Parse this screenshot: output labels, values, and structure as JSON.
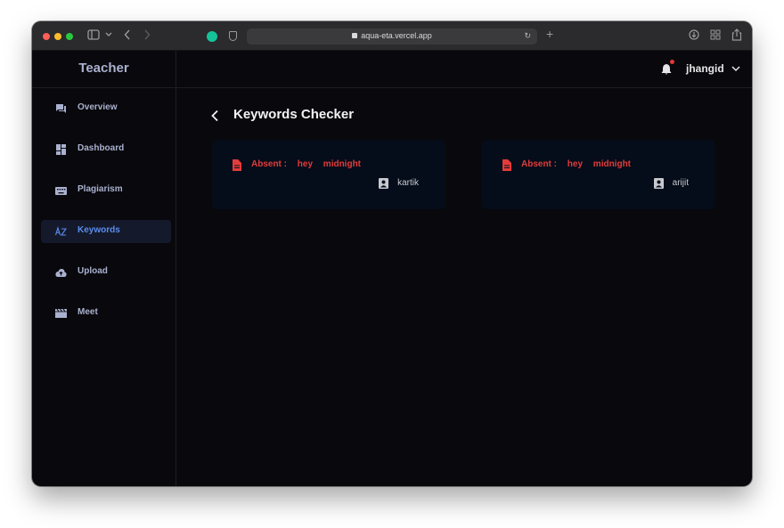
{
  "browser": {
    "url": "aqua-eta.vercel.app"
  },
  "app": {
    "brand": "Teacher",
    "user": "jhangid"
  },
  "sidebar": {
    "items": [
      {
        "label": "Overview",
        "icon": "forum-icon",
        "active": false
      },
      {
        "label": "Dashboard",
        "icon": "dashboard-icon",
        "active": false
      },
      {
        "label": "Plagiarism",
        "icon": "keyboard-icon",
        "active": false
      },
      {
        "label": "Keywords",
        "icon": "sort-by-alpha-icon",
        "active": true
      },
      {
        "label": "Upload",
        "icon": "cloud-upload-icon",
        "active": false
      },
      {
        "label": "Meet",
        "icon": "movie-icon",
        "active": false
      }
    ]
  },
  "page": {
    "title": "Keywords Checker"
  },
  "cards": [
    {
      "absent_label": "Absent :",
      "keywords": [
        "hey",
        "midnight"
      ],
      "student": "kartik"
    },
    {
      "absent_label": "Absent :",
      "keywords": [
        "hey",
        "midnight"
      ],
      "student": "arijit"
    }
  ],
  "colors": {
    "accent": "#5b8def",
    "absent": "#e53b3b",
    "card_bg": "#050d1a",
    "app_bg": "#09080c",
    "notification_dot": "#e53935"
  }
}
